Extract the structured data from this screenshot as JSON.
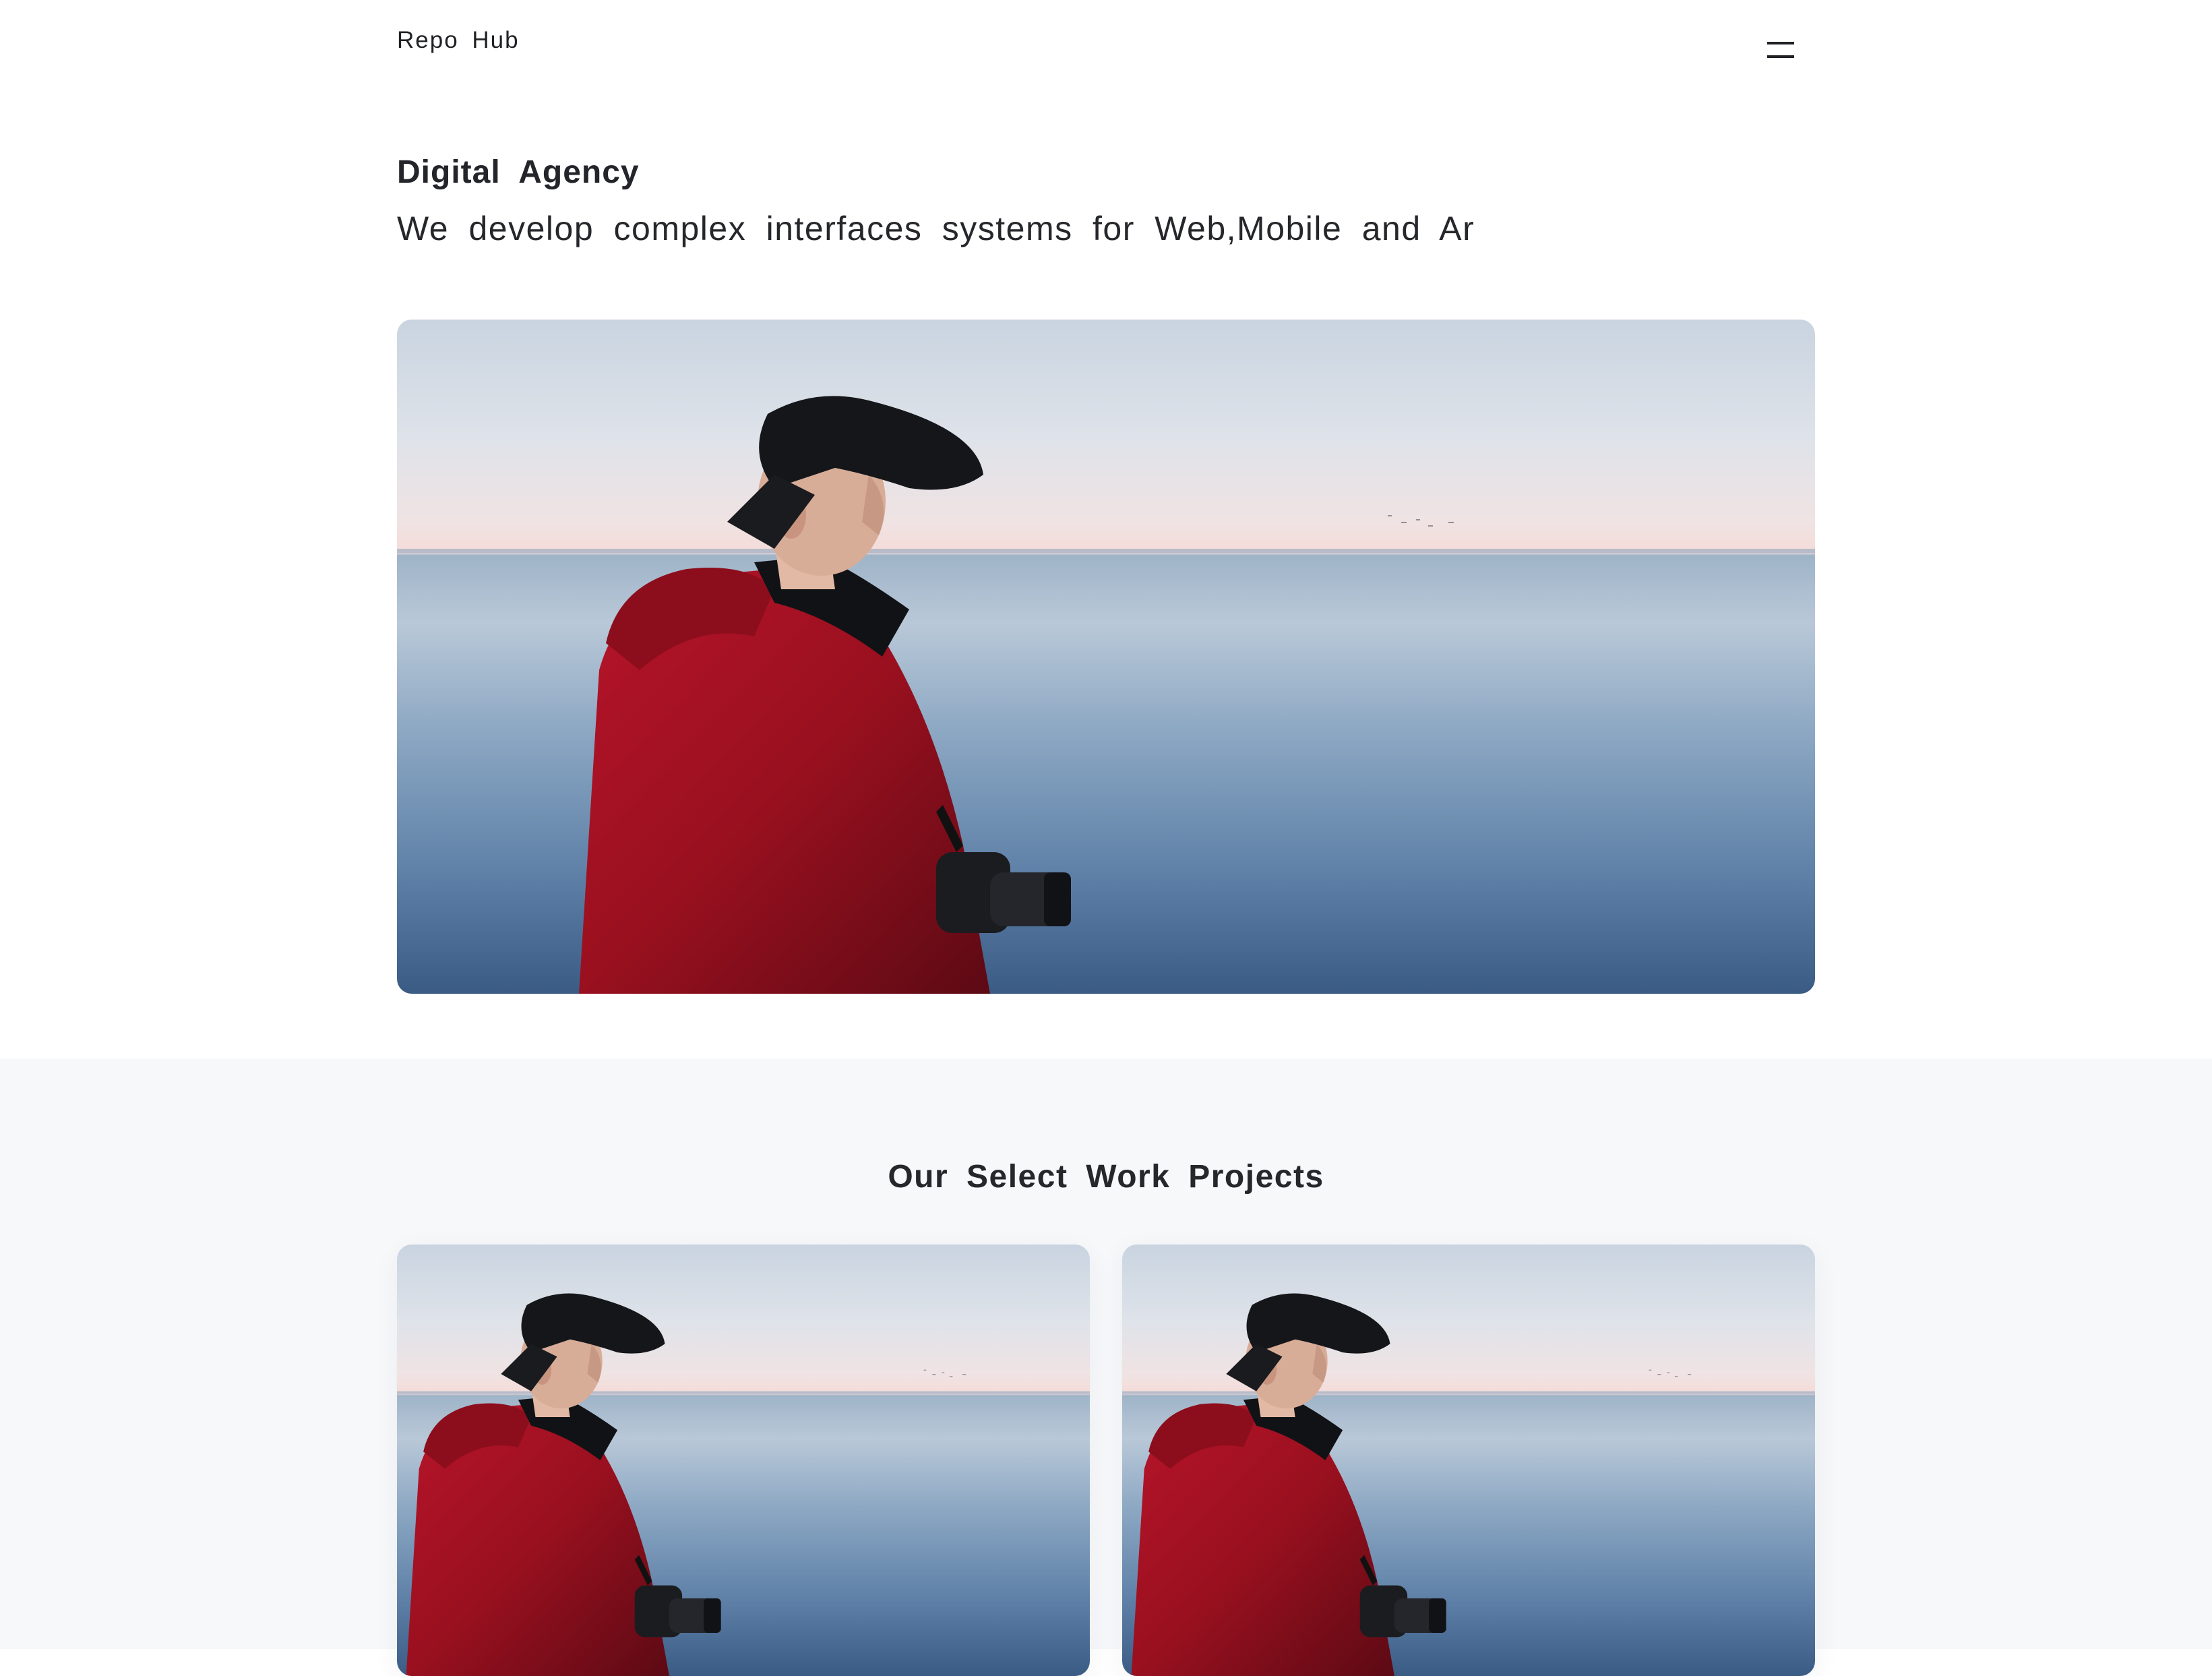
{
  "header": {
    "brand": "Repo Hub",
    "menu_icon": "hamburger-menu-icon"
  },
  "hero": {
    "title": "Digital Agency",
    "subtitle": "We develop complex interfaces systems for Web,Mobile and Ar",
    "image": "photo-man-red-jacket-camera-sea"
  },
  "projects": {
    "title": "Our Select Work Projects",
    "cards": [
      {
        "image": "photo-man-red-jacket-camera-sea"
      },
      {
        "image": "photo-man-red-jacket-camera-sea"
      }
    ]
  },
  "colors": {
    "text": "#222428",
    "section_bg": "#f7f8fa",
    "jacket": "#a0101c",
    "sea": "#3f6690"
  }
}
